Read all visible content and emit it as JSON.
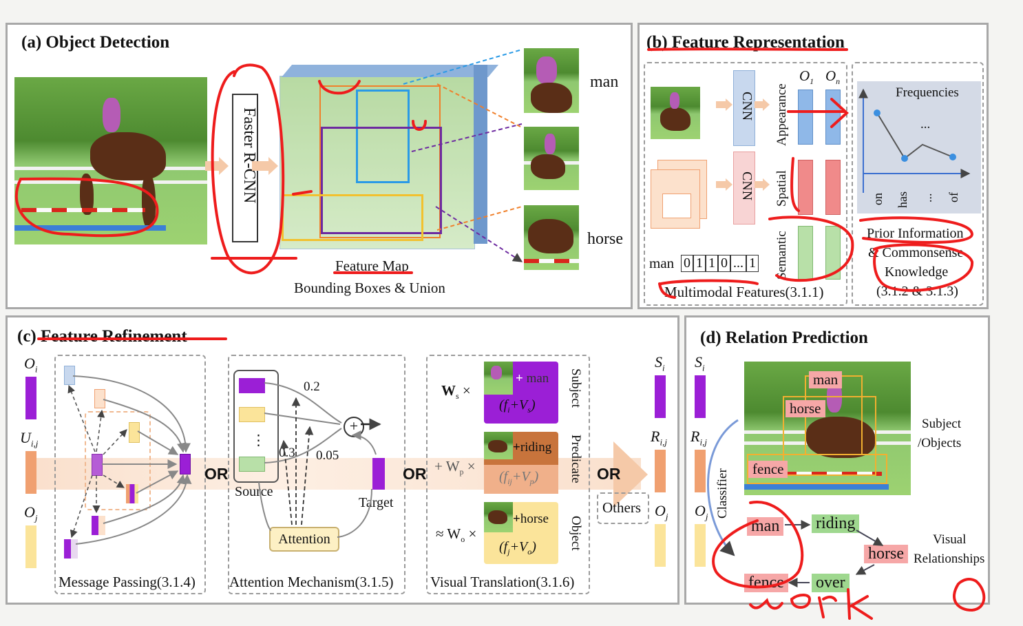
{
  "panels": {
    "a": {
      "title": "(a) Object Detection",
      "model": "Faster R-CNN",
      "labels": [
        "man",
        "horse"
      ],
      "caption1": "Feature Map",
      "caption2": "Bounding Boxes & Union"
    },
    "b": {
      "title_prefix": "(b) ",
      "title": "Feature Representation",
      "cnn": "CNN",
      "rows": [
        "Appearance",
        "Spatial",
        "Semantic"
      ],
      "o1": "O",
      "o1_sub": "1",
      "on": "O",
      "on_sub": "n",
      "vec_word": "man",
      "vec_vals": [
        "0",
        "1",
        "1",
        "0",
        "...",
        "1"
      ],
      "multimodal": "Multimodal Features(3.1.1)",
      "chart_title": "Frequencies",
      "chart_x": [
        "on",
        "has",
        "...",
        "of"
      ],
      "chart_dots": "...",
      "prior1": "Prior Information",
      "prior2": "& Commonsense",
      "prior3": "Knowledge",
      "prior_ref": "(3.1.2 & 3.1.3)"
    },
    "c": {
      "title_prefix": "(c) ",
      "title": "Feature Refinement",
      "oi": "O",
      "oi_sub": "i",
      "uij": "U",
      "uij_sub": "i,j",
      "oj": "O",
      "oj_sub": "j",
      "mp": "Message Passing(3.1.4)",
      "or": "OR",
      "source": "Source",
      "target": "Target",
      "attention": "Attention",
      "w02": "0.2",
      "w03": "0.3",
      "w005": "0.05",
      "am": "Attention Mechanism(3.1.5)",
      "ws": "W",
      "ws_sub": "s",
      "wp_prefix": "+ W",
      "wp_sub": "p",
      "wo_prefix": "≈ W",
      "wo_sub": "o",
      "times": "×",
      "t_man": "man",
      "t_riding": "riding",
      "t_horse": "horse",
      "f_s": "(f",
      "f_s_sub": "i",
      "plus_v": "+V",
      "v_s_sub": "s",
      "f_p_sub": "ij",
      "v_p_sub": "p",
      "f_o_sub": "j",
      "v_o_sub": "o",
      "close": ")",
      "subject": "Subject",
      "predicate": "Predicate",
      "object": "Object",
      "vt": "Visual Translation(3.1.6)",
      "others": "Others",
      "si": "S",
      "si_sub": "i",
      "rij": "R",
      "rij_sub": "i,j",
      "oj2": "O",
      "oj2_sub": "j"
    },
    "d": {
      "title": "(d) Relation Prediction",
      "si": "S",
      "si_sub": "i",
      "rij": "R",
      "rij_sub": "i,j",
      "oj": "O",
      "oj_sub": "j",
      "classifier": "Classifier",
      "tags": [
        "man",
        "horse",
        "fence"
      ],
      "subj_obj1": "Subject",
      "subj_obj2": "/Objects",
      "nodes": [
        "man",
        "riding",
        "horse",
        "fence",
        "over"
      ],
      "vr1": "Visual",
      "vr2": "Relationships"
    }
  },
  "annotation": {
    "handwriting": "work"
  },
  "colors": {
    "purple": "#9b1fd6",
    "orange": "#f0a070",
    "yellow": "#fbe49a",
    "blue": "#8fb8e8",
    "red": "#ee1c1c",
    "green": "#9fd88f",
    "pink": "#f6a7a7"
  }
}
